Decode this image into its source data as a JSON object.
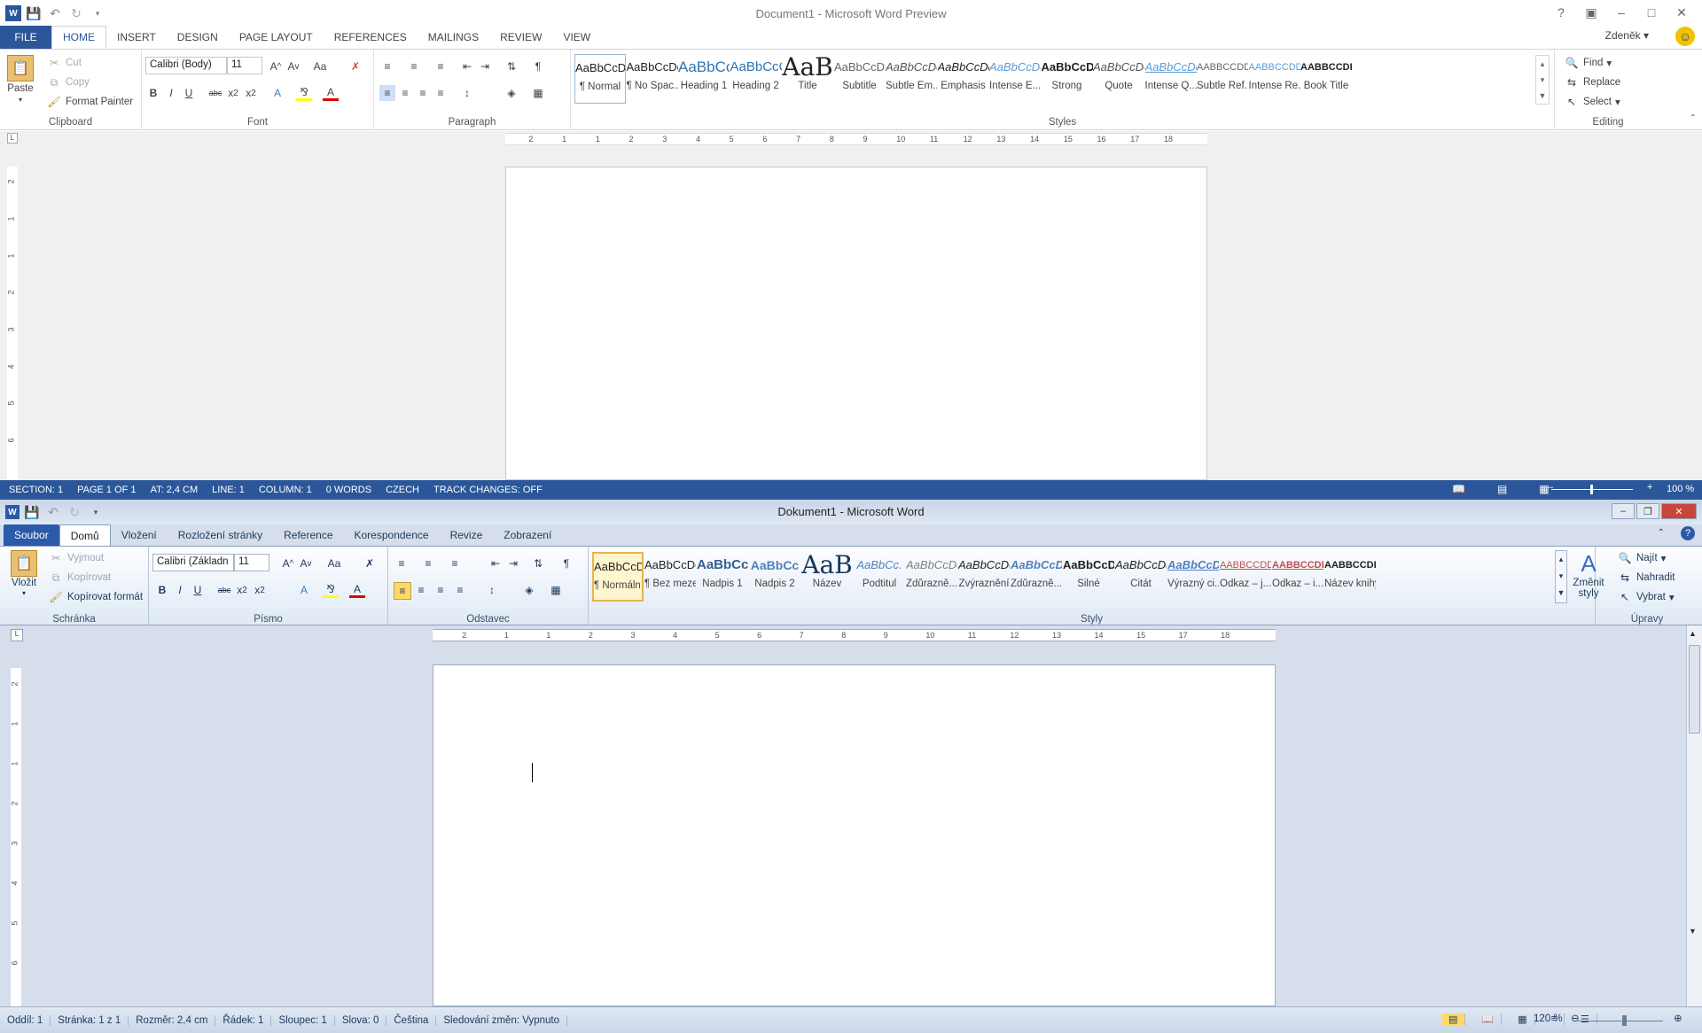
{
  "top": {
    "title": "Document1 - Microsoft Word Preview",
    "tabs": [
      "FILE",
      "HOME",
      "INSERT",
      "DESIGN",
      "PAGE LAYOUT",
      "REFERENCES",
      "MAILINGS",
      "REVIEW",
      "VIEW"
    ],
    "user": "Zdeněk",
    "clipboard": {
      "paste": "Paste",
      "cut": "Cut",
      "copy": "Copy",
      "format_painter": "Format Painter",
      "label": "Clipboard"
    },
    "font": {
      "name": "Calibri (Body)",
      "size": "11",
      "label": "Font"
    },
    "paragraph": {
      "label": "Paragraph"
    },
    "styles": {
      "label": "Styles",
      "items": [
        {
          "sample": "AaBbCcDc",
          "name": "¶ Normal"
        },
        {
          "sample": "AaBbCcDc",
          "name": "¶ No Spac..."
        },
        {
          "sample": "AaBbCc",
          "name": "Heading 1"
        },
        {
          "sample": "AaBbCcC",
          "name": "Heading 2"
        },
        {
          "sample": "AaB",
          "name": "Title"
        },
        {
          "sample": "AaBbCcD",
          "name": "Subtitle"
        },
        {
          "sample": "AaBbCcDc",
          "name": "Subtle Em..."
        },
        {
          "sample": "AaBbCcDc",
          "name": "Emphasis"
        },
        {
          "sample": "AaBbCcDc",
          "name": "Intense E..."
        },
        {
          "sample": "AaBbCcDc",
          "name": "Strong"
        },
        {
          "sample": "AaBbCcDc",
          "name": "Quote"
        },
        {
          "sample": "AaBbCcDc",
          "name": "Intense Q..."
        },
        {
          "sample": "AABBCCDD",
          "name": "Subtle Ref..."
        },
        {
          "sample": "AABBCCDD",
          "name": "Intense Re..."
        },
        {
          "sample": "AABBCCDD",
          "name": "Book Title"
        }
      ]
    },
    "editing": {
      "find": "Find",
      "replace": "Replace",
      "select": "Select",
      "label": "Editing"
    },
    "ruler": [
      "2",
      "1",
      "1",
      "2",
      "3",
      "4",
      "5",
      "6",
      "7",
      "8",
      "9",
      "10",
      "11",
      "12",
      "13",
      "14",
      "15",
      "16",
      "17",
      "18"
    ],
    "vruler": [
      "2",
      "1",
      "1",
      "2",
      "3",
      "4",
      "5",
      "6"
    ],
    "status": [
      "SECTION: 1",
      "PAGE 1 OF 1",
      "AT: 2,4 CM",
      "LINE: 1",
      "COLUMN: 1",
      "0 WORDS",
      "CZECH",
      "TRACK CHANGES: OFF"
    ],
    "zoom": "100 %"
  },
  "bottom": {
    "title": "Dokument1 - Microsoft Word",
    "tabs": [
      "Soubor",
      "Domů",
      "Vložení",
      "Rozložení stránky",
      "Reference",
      "Korespondence",
      "Revize",
      "Zobrazení"
    ],
    "clipboard": {
      "paste": "Vložit",
      "cut": "Vyjmout",
      "copy": "Kopírovat",
      "format_painter": "Kopírovat formát",
      "label": "Schránka"
    },
    "font": {
      "name": "Calibri (Základn",
      "size": "11",
      "label": "Písmo"
    },
    "paragraph": {
      "label": "Odstavec"
    },
    "styles": {
      "label": "Styly",
      "change": "Změnit styly",
      "items": [
        {
          "sample": "AaBbCcDc",
          "name": "¶ Normální"
        },
        {
          "sample": "AaBbCcDc",
          "name": "¶ Bez mezer"
        },
        {
          "sample": "AaBbCc",
          "name": "Nadpis 1"
        },
        {
          "sample": "AaBbCc",
          "name": "Nadpis 2"
        },
        {
          "sample": "AaB",
          "name": "Název"
        },
        {
          "sample": "AaBbCc.",
          "name": "Podtitul"
        },
        {
          "sample": "AaBbCcDc",
          "name": "Zdůrazně..."
        },
        {
          "sample": "AaBbCcDc",
          "name": "Zvýraznění"
        },
        {
          "sample": "AaBbCcDc",
          "name": "Zdůrazně..."
        },
        {
          "sample": "AaBbCcDc",
          "name": "Silné"
        },
        {
          "sample": "AaBbCcDc",
          "name": "Citát"
        },
        {
          "sample": "AaBbCcDc",
          "name": "Výrazný ci..."
        },
        {
          "sample": "AABBCCDD",
          "name": "Odkaz – j..."
        },
        {
          "sample": "AABBCCDD",
          "name": "Odkaz – i..."
        },
        {
          "sample": "AABBCCDD",
          "name": "Název knihy"
        }
      ]
    },
    "editing": {
      "find": "Najít",
      "replace": "Nahradit",
      "select": "Vybrat",
      "label": "Úpravy"
    },
    "ruler": [
      "2",
      "1",
      "1",
      "2",
      "3",
      "4",
      "5",
      "6",
      "7",
      "8",
      "9",
      "10",
      "11",
      "12",
      "13",
      "14",
      "15",
      "17",
      "18"
    ],
    "vruler": [
      "2",
      "1",
      "1",
      "2",
      "3",
      "4",
      "5",
      "6"
    ],
    "status": [
      "Oddíl: 1",
      "Stránka: 1 z 1",
      "Rozměr: 2,4 cm",
      "Řádek: 1",
      "Sloupec: 1",
      "Slova: 0",
      "Čeština",
      "Sledování změn: Vypnuto"
    ],
    "zoom": "120 %"
  }
}
